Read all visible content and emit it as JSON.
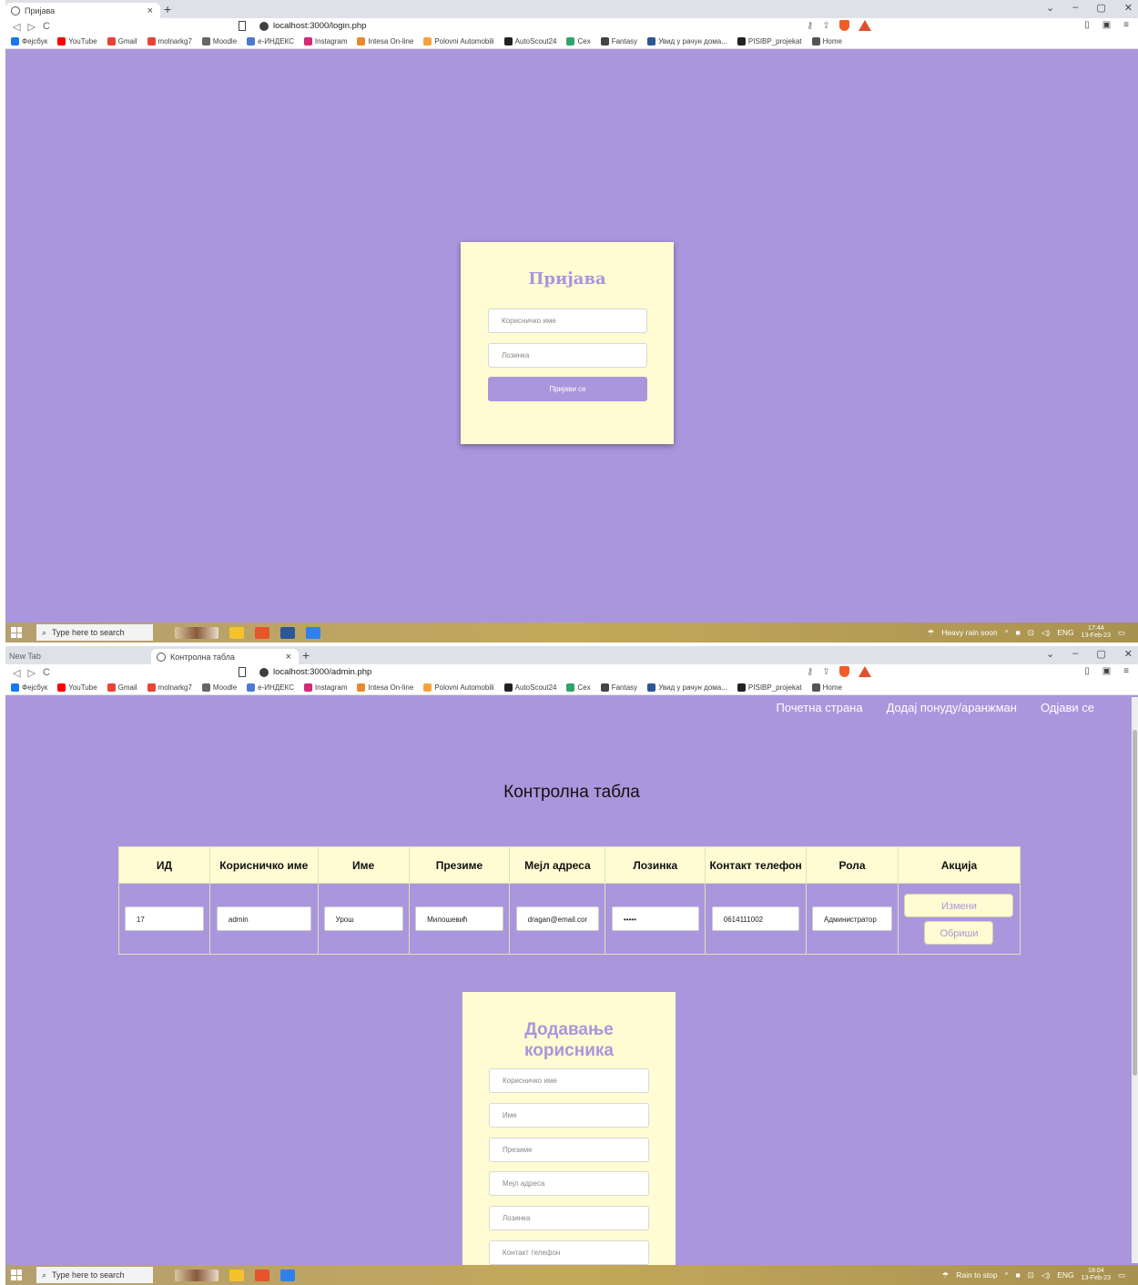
{
  "browser": {
    "nav": {
      "back": "◁",
      "forward": "▷",
      "reload": "C"
    },
    "bookmarks": [
      "Фејсбук",
      "YouTube",
      "Gmail",
      "molnarkg7",
      "Moodle",
      "е-ИНДЕКС",
      "Instagram",
      "Intesa On-line",
      "Polovni Automobili",
      "AutoScout24",
      "Cex",
      "Fantasy",
      "Увид у рачун дома...",
      "PISIBP_projekat",
      "Home"
    ],
    "window_controls": [
      "⌄",
      "–",
      "▢",
      "✕"
    ]
  },
  "login_window": {
    "tab_title": "Пријава",
    "url": "localhost:3000/login.php",
    "form": {
      "title": "Пријава",
      "username_placeholder": "Корисничко име",
      "password_placeholder": "Лозинка",
      "submit_label": "Пријави се"
    },
    "taskbar": {
      "search": "Type here to search",
      "weather": "Heavy rain soon",
      "lang": "ENG",
      "time": "17:44",
      "date": "13-Feb-23"
    }
  },
  "admin_window": {
    "tab_inactive": "New Tab",
    "tab_title": "Контролна табла",
    "url": "localhost:3000/admin.php",
    "nav": [
      "Почетна страна",
      "Додај понуду/аранжман",
      "Одјави се"
    ],
    "heading": "Контролна табла",
    "table": {
      "headers": [
        "ИД",
        "Корисничко име",
        "Име",
        "Презиме",
        "Мејл адреса",
        "Лозинка",
        "Контакт телефон",
        "Рола",
        "Акција"
      ],
      "rows": [
        {
          "id": "17",
          "username": "admin",
          "first_name": "Урош",
          "last_name": "Милошевић",
          "email": "dragan@email.cor",
          "password": "•••••",
          "phone": "0614111002",
          "role": "Администратор"
        }
      ],
      "edit_label": "Измени",
      "delete_label": "Обриши"
    },
    "add_form": {
      "title_line1": "Додавање",
      "title_line2": "корисника",
      "placeholders": [
        "Корисничко име",
        "Име",
        "Презиме",
        "Мејл адреса",
        "Лозинка",
        "Контакт телефон"
      ]
    },
    "taskbar": {
      "search": "Type here to search",
      "weather": "Rain to stop",
      "lang": "ENG",
      "time": "18:04",
      "date": "13-Feb-23"
    }
  }
}
